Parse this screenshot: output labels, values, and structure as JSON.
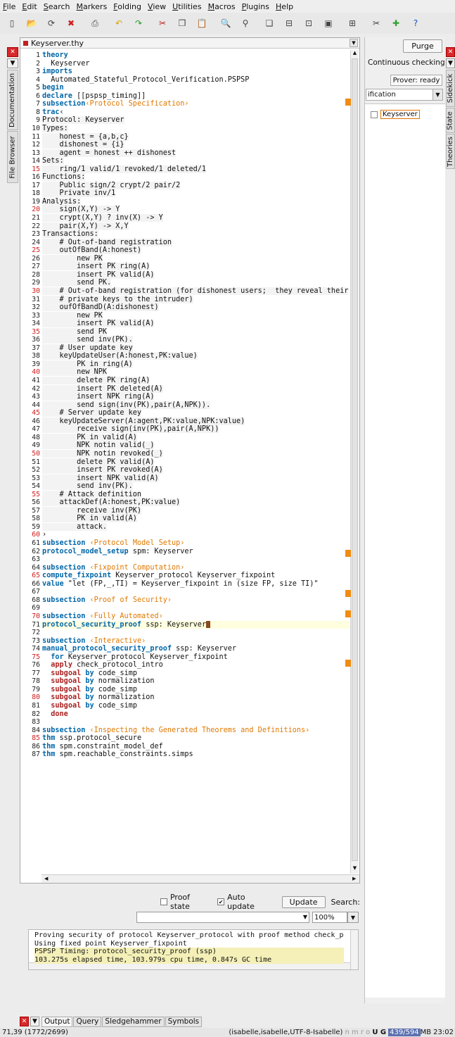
{
  "menu": [
    "File",
    "Edit",
    "Search",
    "Markers",
    "Folding",
    "View",
    "Utilities",
    "Macros",
    "Plugins",
    "Help"
  ],
  "toolbar_icons": [
    "new-file-icon",
    "open-file-icon",
    "reload-icon",
    "close-file-icon",
    "print-icon",
    "undo-icon",
    "redo-icon",
    "cut-icon",
    "copy-icon",
    "paste-icon",
    "find-icon",
    "find-replace-icon",
    "new-view-icon",
    "split-horizontal-icon",
    "split-vertical-icon",
    "unsplit-icon",
    "fullscreen-icon",
    "options-icon",
    "plugin-icon",
    "help-icon"
  ],
  "left_tabs": [
    "Documentation",
    "File Browser"
  ],
  "right_tabs": [
    "Sidekick",
    "State",
    "Theories"
  ],
  "editor": {
    "file_name": "Keyserver.thy",
    "lines": [
      {
        "n": "1",
        "t": "theory"
      },
      {
        "n": "2",
        "t": "  Keyserver"
      },
      {
        "n": "3",
        "t": "imports"
      },
      {
        "n": "4",
        "t": "  Automated_Stateful_Protocol_Verification.PSPSP"
      },
      {
        "n": "5",
        "t": "begin"
      },
      {
        "n": "6",
        "t": "declare [[pspsp_timing]]"
      },
      {
        "n": "7",
        "t": "subsection‹Protocol Specification›"
      },
      {
        "n": "8",
        "t": "trac‹"
      },
      {
        "n": "9",
        "t": "Protocol: Keyserver"
      },
      {
        "n": "10",
        "t": "Types:"
      },
      {
        "n": "11",
        "t": "    honest = {a,b,c}"
      },
      {
        "n": "12",
        "t": "    dishonest = {i}"
      },
      {
        "n": "13",
        "t": "    agent = honest ++ dishonest"
      },
      {
        "n": "14",
        "t": "Sets:"
      },
      {
        "n": "15",
        "t": "    ring/1 valid/1 revoked/1 deleted/1"
      },
      {
        "n": "16",
        "t": "Functions:"
      },
      {
        "n": "17",
        "t": "    Public sign/2 crypt/2 pair/2"
      },
      {
        "n": "18",
        "t": "    Private inv/1"
      },
      {
        "n": "19",
        "t": "Analysis:"
      },
      {
        "n": "20",
        "t": "    sign(X,Y) -> Y"
      },
      {
        "n": "21",
        "t": "    crypt(X,Y) ? inv(X) -> Y"
      },
      {
        "n": "22",
        "t": "    pair(X,Y) -> X,Y"
      },
      {
        "n": "23",
        "t": "Transactions:"
      },
      {
        "n": "24",
        "t": "    # Out-of-band registration"
      },
      {
        "n": "25",
        "t": "    outOfBand(A:honest)"
      },
      {
        "n": "26",
        "t": "        new PK"
      },
      {
        "n": "27",
        "t": "        insert PK ring(A)"
      },
      {
        "n": "28",
        "t": "        insert PK valid(A)"
      },
      {
        "n": "29",
        "t": "        send PK."
      },
      {
        "n": "30",
        "t": "    # Out-of-band registration (for dishonest users;  they reveal their"
      },
      {
        "n": "31",
        "t": "    # private keys to the intruder)"
      },
      {
        "n": "32",
        "t": "    oufOfBandD(A:dishonest)"
      },
      {
        "n": "33",
        "t": "        new PK"
      },
      {
        "n": "34",
        "t": "        insert PK valid(A)"
      },
      {
        "n": "35",
        "t": "        send PK"
      },
      {
        "n": "36",
        "t": "        send inv(PK)."
      },
      {
        "n": "37",
        "t": "    # User update key"
      },
      {
        "n": "38",
        "t": "    keyUpdateUser(A:honest,PK:value)"
      },
      {
        "n": "39",
        "t": "        PK in ring(A)"
      },
      {
        "n": "40",
        "t": "        new NPK"
      },
      {
        "n": "41",
        "t": "        delete PK ring(A)"
      },
      {
        "n": "42",
        "t": "        insert PK deleted(A)"
      },
      {
        "n": "43",
        "t": "        insert NPK ring(A)"
      },
      {
        "n": "44",
        "t": "        send sign(inv(PK),pair(A,NPK))."
      },
      {
        "n": "45",
        "t": "    # Server update key"
      },
      {
        "n": "46",
        "t": "    keyUpdateServer(A:agent,PK:value,NPK:value)"
      },
      {
        "n": "47",
        "t": "        receive sign(inv(PK),pair(A,NPK))"
      },
      {
        "n": "48",
        "t": "        PK in valid(A)"
      },
      {
        "n": "49",
        "t": "        NPK notin valid(_)"
      },
      {
        "n": "50",
        "t": "        NPK notin revoked(_)"
      },
      {
        "n": "51",
        "t": "        delete PK valid(A)"
      },
      {
        "n": "52",
        "t": "        insert PK revoked(A)"
      },
      {
        "n": "53",
        "t": "        insert NPK valid(A)"
      },
      {
        "n": "54",
        "t": "        send inv(PK)."
      },
      {
        "n": "55",
        "t": "    # Attack definition"
      },
      {
        "n": "56",
        "t": "    attackDef(A:honest,PK:value)"
      },
      {
        "n": "57",
        "t": "        receive inv(PK)"
      },
      {
        "n": "58",
        "t": "        PK in valid(A)"
      },
      {
        "n": "59",
        "t": "        attack."
      },
      {
        "n": "60",
        "t": "›"
      },
      {
        "n": "61",
        "t": "subsection ‹Protocol Model Setup›"
      },
      {
        "n": "62",
        "t": "protocol_model_setup spm: Keyserver"
      },
      {
        "n": "63",
        "t": ""
      },
      {
        "n": "64",
        "t": "subsection ‹Fixpoint Computation›"
      },
      {
        "n": "65",
        "t": "compute_fixpoint Keyserver_protocol Keyserver_fixpoint"
      },
      {
        "n": "66",
        "t": "value \"let (FP,_,TI) = Keyserver_fixpoint in (size FP, size TI)\""
      },
      {
        "n": "67",
        "t": ""
      },
      {
        "n": "68",
        "t": "subsection ‹Proof of Security›"
      },
      {
        "n": "69",
        "t": ""
      },
      {
        "n": "70",
        "t": "subsection ‹Fully Automated›"
      },
      {
        "n": "71",
        "t": "protocol_security_proof ssp: Keyserver"
      },
      {
        "n": "72",
        "t": ""
      },
      {
        "n": "73",
        "t": "subsection ‹Interactive›"
      },
      {
        "n": "74",
        "t": "manual_protocol_security_proof ssp: Keyserver"
      },
      {
        "n": "75",
        "t": "  for Keyserver_protocol Keyserver_fixpoint"
      },
      {
        "n": "76",
        "t": "  apply check_protocol_intro"
      },
      {
        "n": "77",
        "t": "  subgoal by code_simp"
      },
      {
        "n": "78",
        "t": "  subgoal by normalization"
      },
      {
        "n": "79",
        "t": "  subgoal by code_simp"
      },
      {
        "n": "80",
        "t": "  subgoal by normalization"
      },
      {
        "n": "81",
        "t": "  subgoal by code_simp"
      },
      {
        "n": "82",
        "t": "  done"
      },
      {
        "n": "83",
        "t": ""
      },
      {
        "n": "84",
        "t": "subsection ‹Inspecting the Generated Theorems and Definitions›"
      },
      {
        "n": "85",
        "t": "thm ssp.protocol_secure"
      },
      {
        "n": "86",
        "t": "thm spm.constraint_model_def"
      },
      {
        "n": "87",
        "t": "thm spm.reachable_constraints.simps"
      }
    ]
  },
  "right_panel": {
    "purge_label": "Purge",
    "continuous_checking_label": "Continuous checking",
    "prover_status": "Prover: ready",
    "logic_value": "ification",
    "theory_item": "Keyserver"
  },
  "output_panel": {
    "proof_state_label": "Proof state",
    "auto_update_label": "Auto update",
    "update_label": "Update",
    "search_label": "Search:",
    "zoom_value": "100%",
    "messages": [
      "Proving security of protocol Keyserver_protocol with proof method check_protoc",
      "Using fixed point Keyserver_fixpoint",
      "PSPSP Timing: protocol_security_proof (ssp)",
      "103.275s elapsed time, 103.979s cpu time, 0.847s GC time"
    ],
    "tabs": [
      "Output",
      "Query",
      "Sledgehammer",
      "Symbols"
    ]
  },
  "status_bar": {
    "position": "71,39 (1772/2699)",
    "mode": "(isabelle,isabelle,UTF-8-Isabelle)",
    "flags": "n m r o",
    "ug": "U G",
    "memory": "439/594",
    "memory_unit": "MB",
    "time": "23:02"
  }
}
